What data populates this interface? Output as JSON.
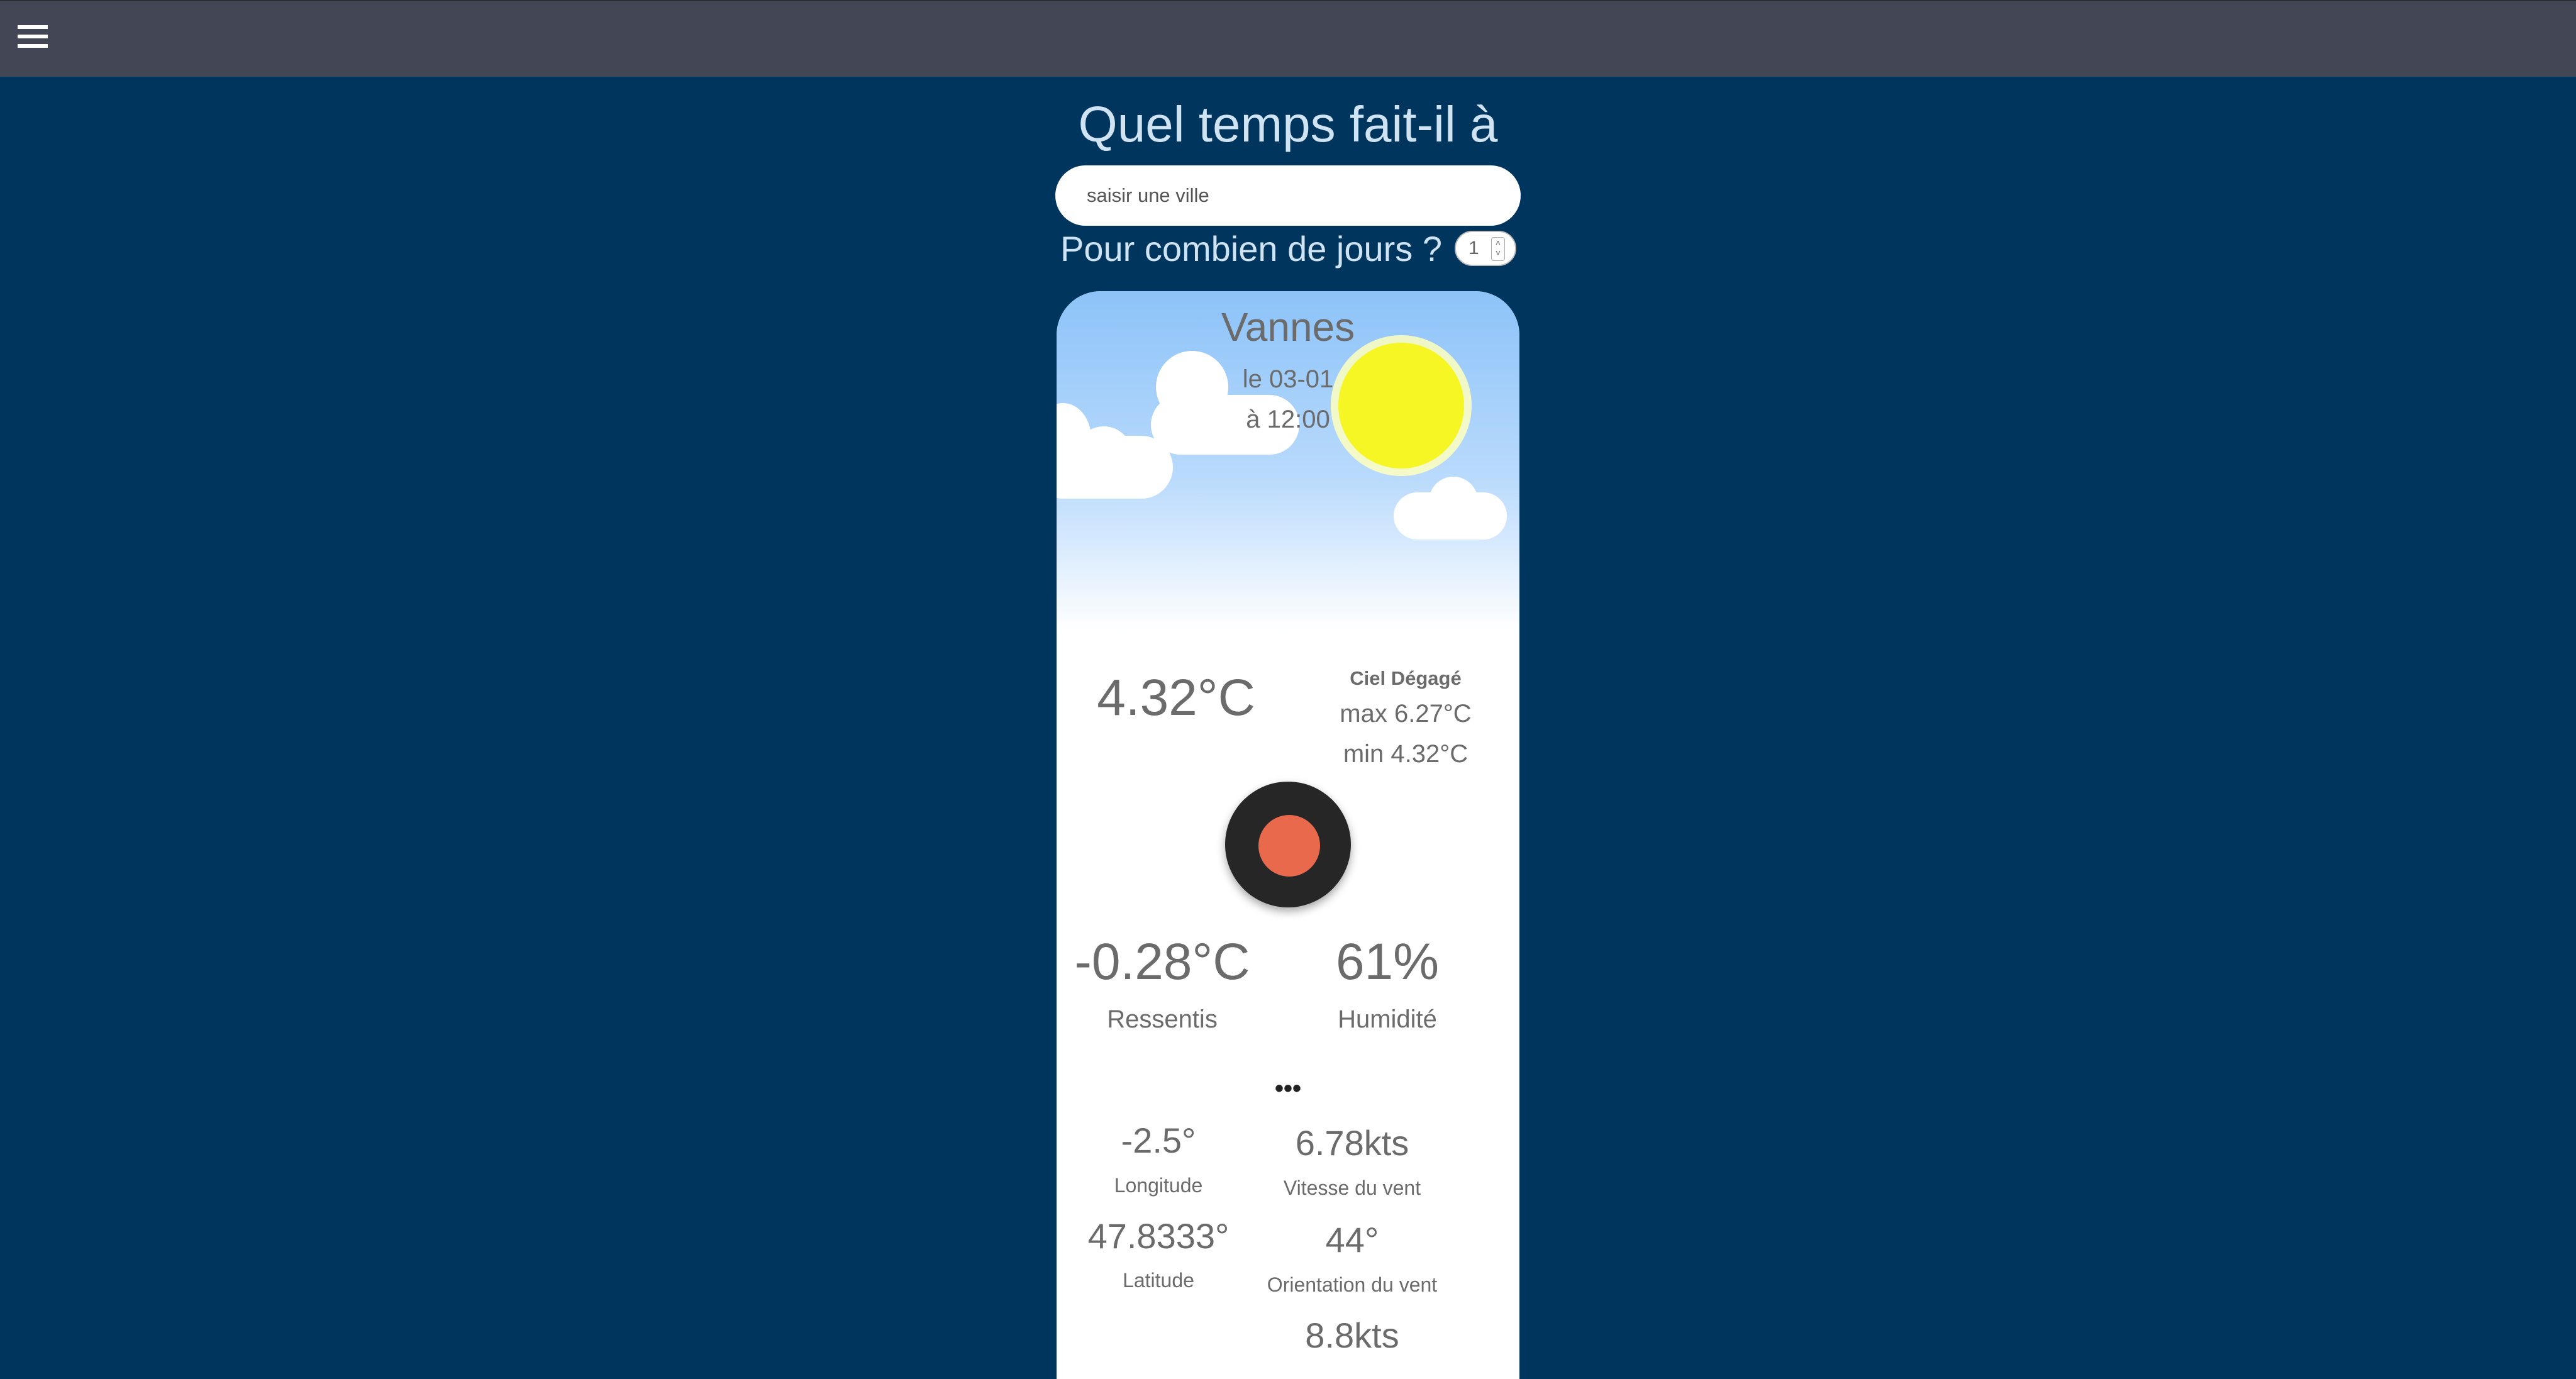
{
  "header": {
    "menu_icon": "hamburger-menu-icon"
  },
  "search": {
    "title": "Quel temps fait-il à",
    "placeholder": "saisir une ville",
    "days_label": "Pour combien de jours ?",
    "days_value": "1"
  },
  "weather": {
    "city": "Vannes",
    "date": "le 03-01",
    "time": "à 12:00",
    "temperature": "4.32°C",
    "description": "Ciel Dégagé",
    "max": "max 6.27°C",
    "min": "min 4.32°C",
    "feels_like": "-0.28°C",
    "feels_like_label": "Ressentis",
    "humidity": "61%",
    "humidity_label": "Humidité",
    "more": "•••",
    "longitude": "-2.5°",
    "longitude_label": "Longitude",
    "latitude": "47.8333°",
    "latitude_label": "Latitude",
    "wind_speed": "6.78kts",
    "wind_speed_label": "Vitesse du vent",
    "wind_direction": "44°",
    "wind_direction_label": "Orientation du vent",
    "wind_gust": "8.8kts"
  },
  "colors": {
    "background": "#00365e",
    "topbar": "#434655",
    "sun": "#f7f625",
    "toggle_dot": "#e8694c"
  }
}
